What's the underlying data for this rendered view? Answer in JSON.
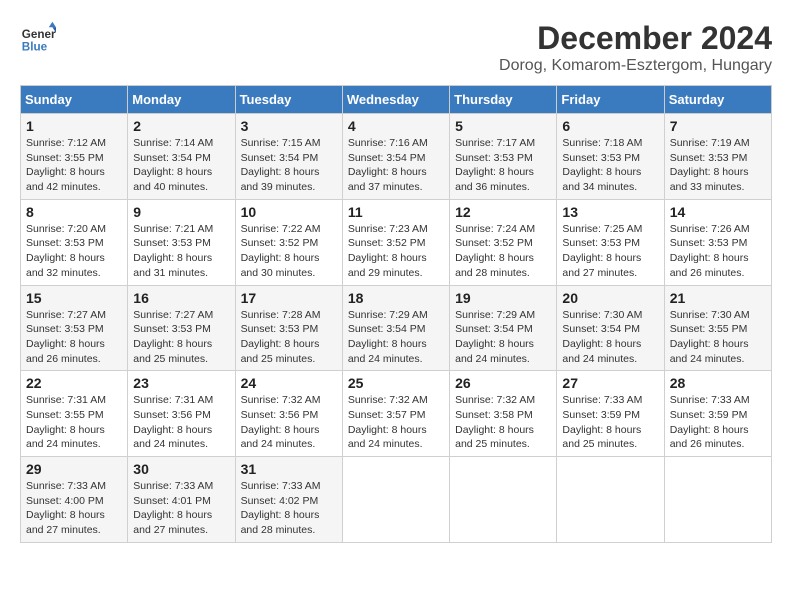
{
  "logo": {
    "line1": "General",
    "line2": "Blue"
  },
  "title": "December 2024",
  "subtitle": "Dorog, Komarom-Esztergom, Hungary",
  "days_of_week": [
    "Sunday",
    "Monday",
    "Tuesday",
    "Wednesday",
    "Thursday",
    "Friday",
    "Saturday"
  ],
  "weeks": [
    [
      {
        "num": "1",
        "rise": "7:12 AM",
        "set": "3:55 PM",
        "hours": "8 hours and 42 minutes."
      },
      {
        "num": "2",
        "rise": "7:14 AM",
        "set": "3:54 PM",
        "hours": "8 hours and 40 minutes."
      },
      {
        "num": "3",
        "rise": "7:15 AM",
        "set": "3:54 PM",
        "hours": "8 hours and 39 minutes."
      },
      {
        "num": "4",
        "rise": "7:16 AM",
        "set": "3:54 PM",
        "hours": "8 hours and 37 minutes."
      },
      {
        "num": "5",
        "rise": "7:17 AM",
        "set": "3:53 PM",
        "hours": "8 hours and 36 minutes."
      },
      {
        "num": "6",
        "rise": "7:18 AM",
        "set": "3:53 PM",
        "hours": "8 hours and 34 minutes."
      },
      {
        "num": "7",
        "rise": "7:19 AM",
        "set": "3:53 PM",
        "hours": "8 hours and 33 minutes."
      }
    ],
    [
      {
        "num": "8",
        "rise": "7:20 AM",
        "set": "3:53 PM",
        "hours": "8 hours and 32 minutes."
      },
      {
        "num": "9",
        "rise": "7:21 AM",
        "set": "3:53 PM",
        "hours": "8 hours and 31 minutes."
      },
      {
        "num": "10",
        "rise": "7:22 AM",
        "set": "3:52 PM",
        "hours": "8 hours and 30 minutes."
      },
      {
        "num": "11",
        "rise": "7:23 AM",
        "set": "3:52 PM",
        "hours": "8 hours and 29 minutes."
      },
      {
        "num": "12",
        "rise": "7:24 AM",
        "set": "3:52 PM",
        "hours": "8 hours and 28 minutes."
      },
      {
        "num": "13",
        "rise": "7:25 AM",
        "set": "3:53 PM",
        "hours": "8 hours and 27 minutes."
      },
      {
        "num": "14",
        "rise": "7:26 AM",
        "set": "3:53 PM",
        "hours": "8 hours and 26 minutes."
      }
    ],
    [
      {
        "num": "15",
        "rise": "7:27 AM",
        "set": "3:53 PM",
        "hours": "8 hours and 26 minutes."
      },
      {
        "num": "16",
        "rise": "7:27 AM",
        "set": "3:53 PM",
        "hours": "8 hours and 25 minutes."
      },
      {
        "num": "17",
        "rise": "7:28 AM",
        "set": "3:53 PM",
        "hours": "8 hours and 25 minutes."
      },
      {
        "num": "18",
        "rise": "7:29 AM",
        "set": "3:54 PM",
        "hours": "8 hours and 24 minutes."
      },
      {
        "num": "19",
        "rise": "7:29 AM",
        "set": "3:54 PM",
        "hours": "8 hours and 24 minutes."
      },
      {
        "num": "20",
        "rise": "7:30 AM",
        "set": "3:54 PM",
        "hours": "8 hours and 24 minutes."
      },
      {
        "num": "21",
        "rise": "7:30 AM",
        "set": "3:55 PM",
        "hours": "8 hours and 24 minutes."
      }
    ],
    [
      {
        "num": "22",
        "rise": "7:31 AM",
        "set": "3:55 PM",
        "hours": "8 hours and 24 minutes."
      },
      {
        "num": "23",
        "rise": "7:31 AM",
        "set": "3:56 PM",
        "hours": "8 hours and 24 minutes."
      },
      {
        "num": "24",
        "rise": "7:32 AM",
        "set": "3:56 PM",
        "hours": "8 hours and 24 minutes."
      },
      {
        "num": "25",
        "rise": "7:32 AM",
        "set": "3:57 PM",
        "hours": "8 hours and 24 minutes."
      },
      {
        "num": "26",
        "rise": "7:32 AM",
        "set": "3:58 PM",
        "hours": "8 hours and 25 minutes."
      },
      {
        "num": "27",
        "rise": "7:33 AM",
        "set": "3:59 PM",
        "hours": "8 hours and 25 minutes."
      },
      {
        "num": "28",
        "rise": "7:33 AM",
        "set": "3:59 PM",
        "hours": "8 hours and 26 minutes."
      }
    ],
    [
      {
        "num": "29",
        "rise": "7:33 AM",
        "set": "4:00 PM",
        "hours": "8 hours and 27 minutes."
      },
      {
        "num": "30",
        "rise": "7:33 AM",
        "set": "4:01 PM",
        "hours": "8 hours and 27 minutes."
      },
      {
        "num": "31",
        "rise": "7:33 AM",
        "set": "4:02 PM",
        "hours": "8 hours and 28 minutes."
      },
      null,
      null,
      null,
      null
    ]
  ],
  "labels": {
    "sunrise": "Sunrise:",
    "sunset": "Sunset:",
    "daylight": "Daylight:"
  }
}
